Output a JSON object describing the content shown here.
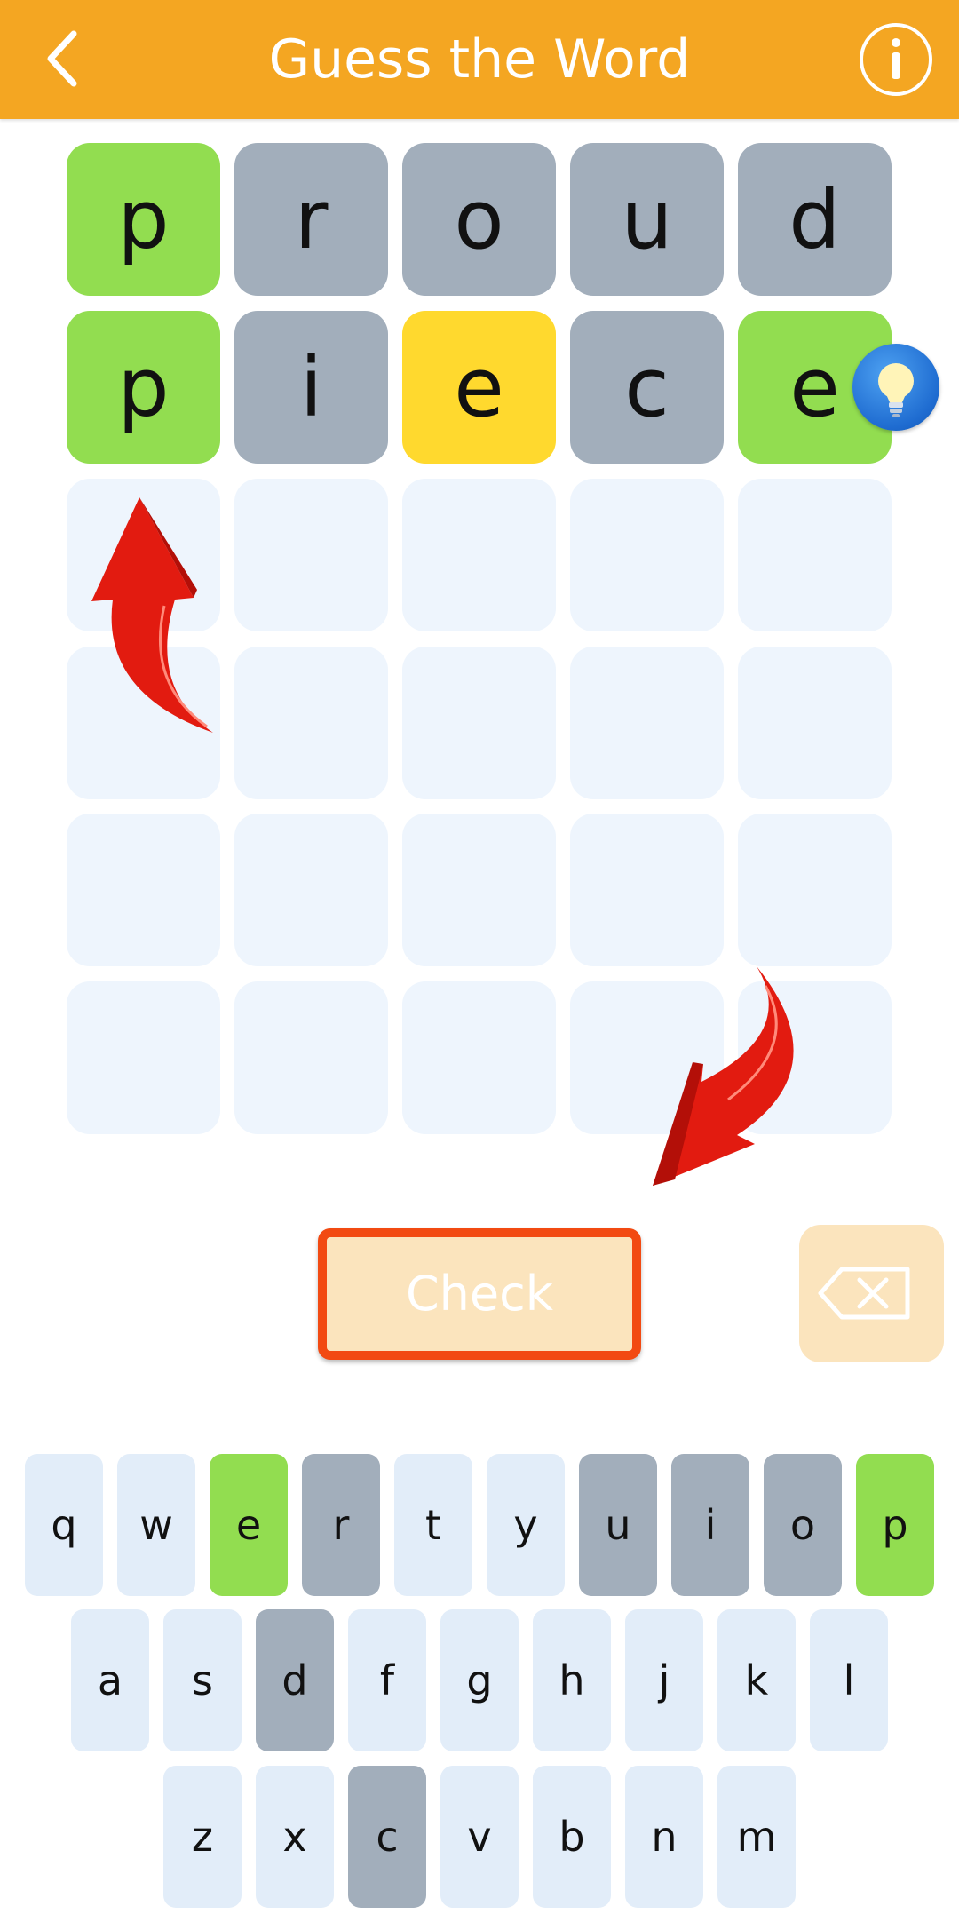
{
  "header": {
    "title": "Guess the Word",
    "back_icon": "chevron-left-icon",
    "info_icon": "info-icon"
  },
  "colors": {
    "header": "#F4A622",
    "correct": "#92DD50",
    "present": "#FFD92E",
    "absent": "#A2AEBB",
    "empty": "#EEF5FD",
    "highlight_border": "#F24A12",
    "button_disabled": "#FBE4BD"
  },
  "board": {
    "rows": [
      [
        {
          "letter": "p",
          "state": "correct"
        },
        {
          "letter": "r",
          "state": "absent"
        },
        {
          "letter": "o",
          "state": "absent"
        },
        {
          "letter": "u",
          "state": "absent"
        },
        {
          "letter": "d",
          "state": "absent"
        }
      ],
      [
        {
          "letter": "p",
          "state": "correct"
        },
        {
          "letter": "i",
          "state": "absent"
        },
        {
          "letter": "e",
          "state": "present"
        },
        {
          "letter": "c",
          "state": "absent"
        },
        {
          "letter": "e",
          "state": "correct"
        }
      ],
      [
        {
          "letter": "",
          "state": "empty"
        },
        {
          "letter": "",
          "state": "empty"
        },
        {
          "letter": "",
          "state": "empty"
        },
        {
          "letter": "",
          "state": "empty"
        },
        {
          "letter": "",
          "state": "empty"
        }
      ],
      [
        {
          "letter": "",
          "state": "empty"
        },
        {
          "letter": "",
          "state": "empty"
        },
        {
          "letter": "",
          "state": "empty"
        },
        {
          "letter": "",
          "state": "empty"
        },
        {
          "letter": "",
          "state": "empty"
        }
      ],
      [
        {
          "letter": "",
          "state": "empty"
        },
        {
          "letter": "",
          "state": "empty"
        },
        {
          "letter": "",
          "state": "empty"
        },
        {
          "letter": "",
          "state": "empty"
        },
        {
          "letter": "",
          "state": "empty"
        }
      ],
      [
        {
          "letter": "",
          "state": "empty"
        },
        {
          "letter": "",
          "state": "empty"
        },
        {
          "letter": "",
          "state": "empty"
        },
        {
          "letter": "",
          "state": "empty"
        },
        {
          "letter": "",
          "state": "empty"
        }
      ]
    ]
  },
  "hint": {
    "icon": "lightbulb-icon"
  },
  "controls": {
    "check_label": "Check",
    "delete_icon": "backspace-icon"
  },
  "keyboard": {
    "rows": [
      [
        {
          "key": "q",
          "state": "default"
        },
        {
          "key": "w",
          "state": "default"
        },
        {
          "key": "e",
          "state": "correct"
        },
        {
          "key": "r",
          "state": "absent"
        },
        {
          "key": "t",
          "state": "default"
        },
        {
          "key": "y",
          "state": "default"
        },
        {
          "key": "u",
          "state": "absent"
        },
        {
          "key": "i",
          "state": "absent"
        },
        {
          "key": "o",
          "state": "absent"
        },
        {
          "key": "p",
          "state": "correct"
        }
      ],
      [
        {
          "key": "a",
          "state": "default"
        },
        {
          "key": "s",
          "state": "default"
        },
        {
          "key": "d",
          "state": "absent"
        },
        {
          "key": "f",
          "state": "default"
        },
        {
          "key": "g",
          "state": "default"
        },
        {
          "key": "h",
          "state": "default"
        },
        {
          "key": "j",
          "state": "default"
        },
        {
          "key": "k",
          "state": "default"
        },
        {
          "key": "l",
          "state": "default"
        }
      ],
      [
        {
          "key": "z",
          "state": "default"
        },
        {
          "key": "x",
          "state": "default"
        },
        {
          "key": "c",
          "state": "absent"
        },
        {
          "key": "v",
          "state": "default"
        },
        {
          "key": "b",
          "state": "default"
        },
        {
          "key": "n",
          "state": "default"
        },
        {
          "key": "m",
          "state": "default"
        }
      ]
    ]
  }
}
